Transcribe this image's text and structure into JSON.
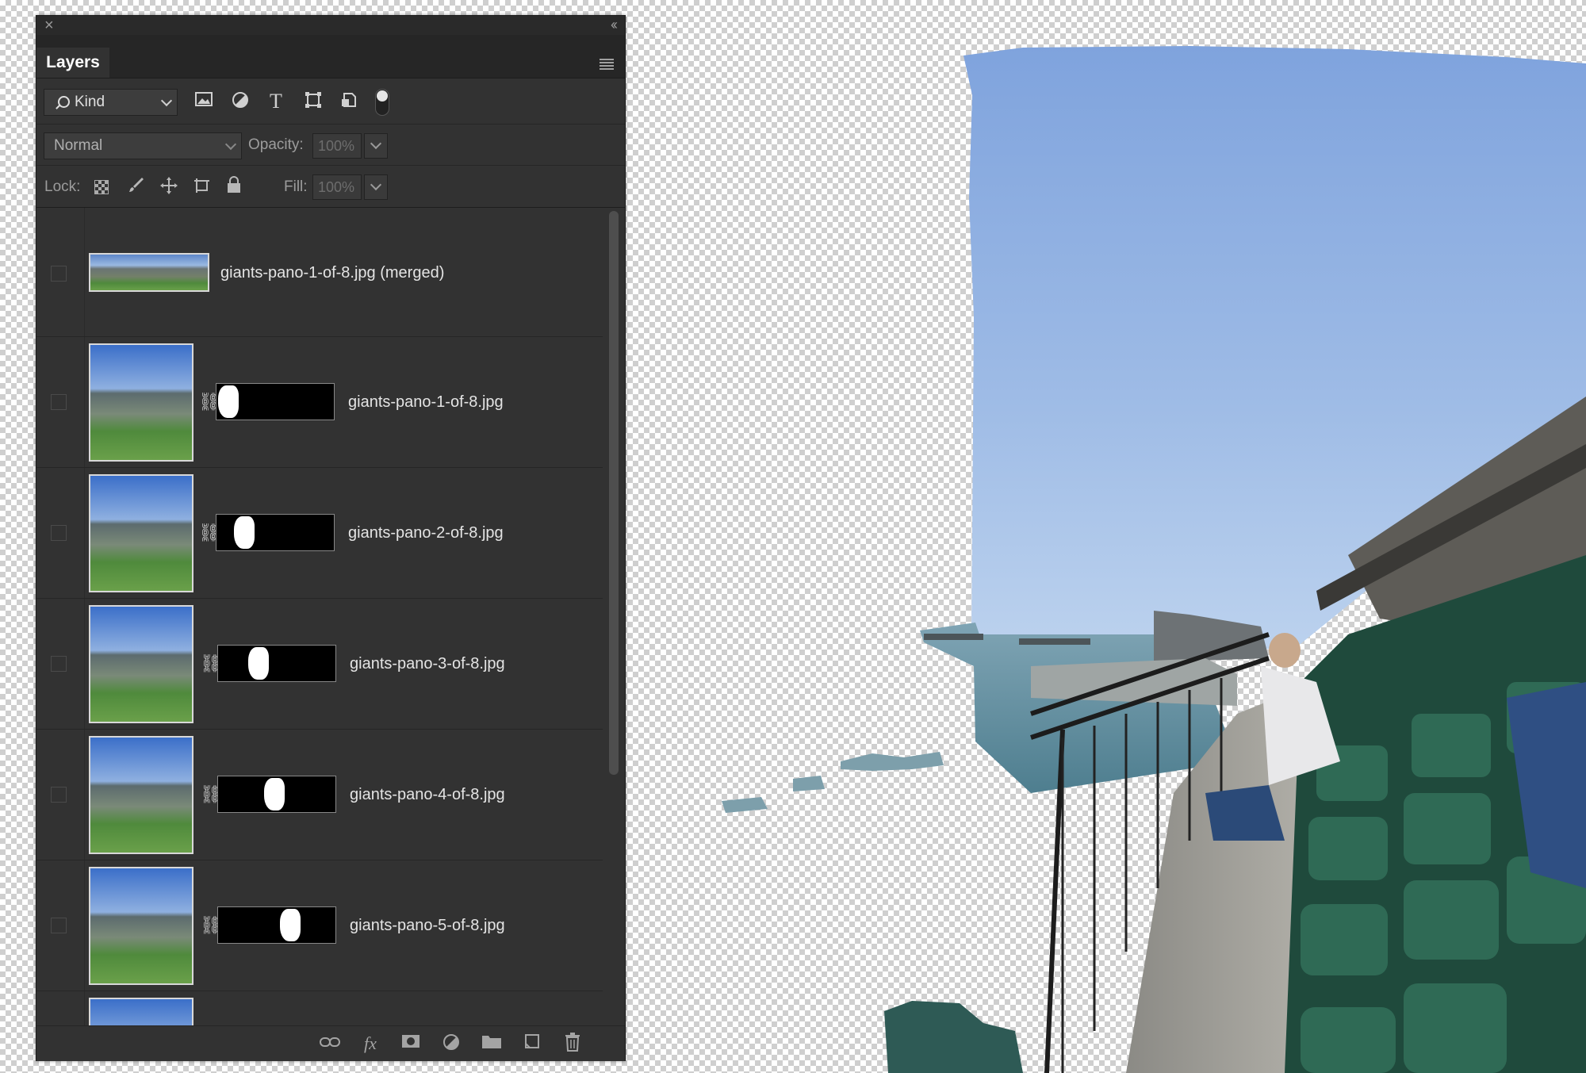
{
  "panel": {
    "title": "Layers",
    "filter": {
      "kind_label": "Kind",
      "icons": [
        "image-filter-icon",
        "adjustment-filter-icon",
        "type-filter-icon",
        "shape-filter-icon",
        "smart-object-filter-icon"
      ]
    },
    "blend_mode": "Normal",
    "opacity_label": "Opacity:",
    "opacity_value": "100%",
    "lock_label": "Lock:",
    "fill_label": "Fill:",
    "fill_value": "100%"
  },
  "layers": [
    {
      "name": "giants-pano-1-of-8.jpg (merged)",
      "has_mask": false
    },
    {
      "name": "giants-pano-1-of-8.jpg",
      "has_mask": true
    },
    {
      "name": "giants-pano-2-of-8.jpg",
      "has_mask": true
    },
    {
      "name": "giants-pano-3-of-8.jpg",
      "has_mask": true
    },
    {
      "name": "giants-pano-4-of-8.jpg",
      "has_mask": true
    },
    {
      "name": "giants-pano-5-of-8.jpg",
      "has_mask": true
    }
  ],
  "footer_icons": [
    "link-layers-icon",
    "fx-icon",
    "add-mask-icon",
    "new-adjustment-icon",
    "new-group-icon",
    "new-layer-icon",
    "delete-layer-icon"
  ],
  "colors": {
    "panel_bg": "#323232",
    "sky": "#8fb0e0",
    "water": "#6e9fae",
    "seats": "#1f4a3c"
  }
}
